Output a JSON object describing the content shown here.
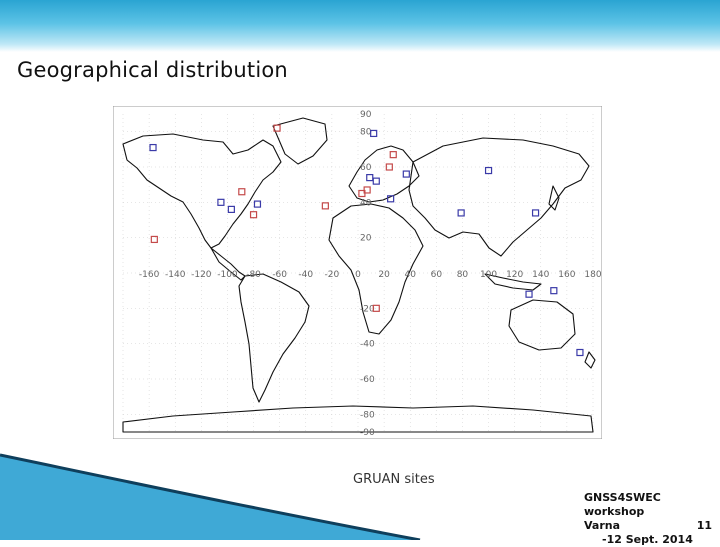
{
  "slide": {
    "title": "Geographical distribution",
    "caption": "GRUAN sites",
    "footer": {
      "line1": "GNSS4SWEC workshop",
      "place": "Varna",
      "day_start": "11",
      "date_rest": "-12 Sept. 2014"
    }
  },
  "map": {
    "lon_ticks": [
      "-160",
      "-140",
      "-120",
      "-100",
      "-80",
      "-60",
      "-40",
      "-20",
      "0",
      "20",
      "40",
      "60",
      "80",
      "100",
      "120",
      "140",
      "160",
      "180"
    ],
    "lat_ticks": [
      "90",
      "80",
      "60",
      "40",
      "20",
      "0",
      "-20",
      "-40",
      "-60",
      "-80",
      "-90"
    ],
    "colors": {
      "blue_site": "#3a3aa8",
      "red_site": "#c44a4a",
      "land": "#111111",
      "grid": "#cccccc"
    },
    "sites": [
      {
        "lon": -157,
        "lat": 71,
        "color": "blue"
      },
      {
        "lon": -156,
        "lat": 19,
        "color": "red"
      },
      {
        "lon": -97,
        "lat": 36,
        "color": "blue"
      },
      {
        "lon": -105,
        "lat": 40,
        "color": "blue"
      },
      {
        "lon": -89,
        "lat": 46,
        "color": "red"
      },
      {
        "lon": -77,
        "lat": 39,
        "color": "blue"
      },
      {
        "lon": -80,
        "lat": 33,
        "color": "red"
      },
      {
        "lon": -62,
        "lat": 82,
        "color": "red"
      },
      {
        "lon": -25,
        "lat": 38,
        "color": "red"
      },
      {
        "lon": 12,
        "lat": 79,
        "color": "blue"
      },
      {
        "lon": 27,
        "lat": 67,
        "color": "red"
      },
      {
        "lon": 24,
        "lat": 60,
        "color": "red"
      },
      {
        "lon": 9,
        "lat": 54,
        "color": "blue"
      },
      {
        "lon": 14,
        "lat": 52,
        "color": "blue"
      },
      {
        "lon": 7,
        "lat": 47,
        "color": "red"
      },
      {
        "lon": 3,
        "lat": 45,
        "color": "red"
      },
      {
        "lon": 25,
        "lat": 42,
        "color": "blue"
      },
      {
        "lon": 37,
        "lat": 56,
        "color": "blue"
      },
      {
        "lon": 79,
        "lat": 34,
        "color": "blue"
      },
      {
        "lon": 100,
        "lat": 58,
        "color": "blue"
      },
      {
        "lon": 136,
        "lat": 34,
        "color": "blue"
      },
      {
        "lon": 150,
        "lat": -10,
        "color": "blue"
      },
      {
        "lon": 131,
        "lat": -12,
        "color": "blue"
      },
      {
        "lon": 14,
        "lat": -20,
        "color": "red"
      },
      {
        "lon": 170,
        "lat": -45,
        "color": "blue"
      }
    ]
  }
}
